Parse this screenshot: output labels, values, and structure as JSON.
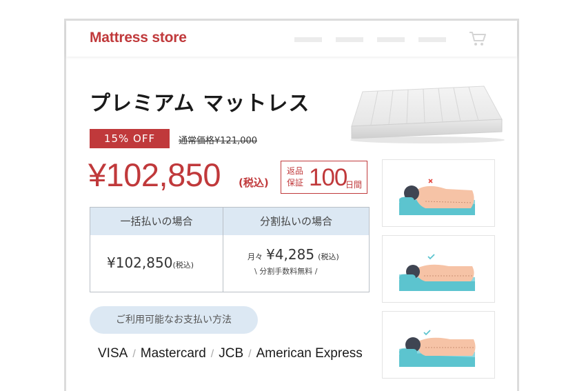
{
  "header": {
    "logo": "Mattress store",
    "nav_items": [
      "",
      "",
      "",
      ""
    ],
    "cart_icon": "cart-icon"
  },
  "product": {
    "title": "プレミアム マットレス",
    "discount_badge": "15% OFF",
    "regular_price": "通常価格¥121,000",
    "price": "¥102,850",
    "tax_label": "(税込)",
    "guarantee": {
      "label_line1": "返品",
      "label_line2": "保証",
      "days": "100",
      "unit": "日間"
    }
  },
  "payment_table": {
    "headers": [
      "一括払いの場合",
      "分割払いの場合"
    ],
    "lump_sum": {
      "amount": "¥102,850",
      "tax": "(税込)"
    },
    "installment": {
      "prefix": "月々",
      "amount": "¥4,285",
      "tax": "(税込)",
      "note": "\\ 分割手数料無料 /"
    }
  },
  "payment_methods": {
    "label": "ご利用可能なお支払い方法",
    "brands": [
      "VISA",
      "Mastercard",
      "JCB",
      "American Express"
    ]
  },
  "sleep_poses": [
    "bad-posture",
    "good-posture",
    "good-posture"
  ],
  "colors": {
    "brand_red": "#c0393b",
    "light_blue": "#dce8f3",
    "pillow_teal": "#5cc4cf"
  }
}
